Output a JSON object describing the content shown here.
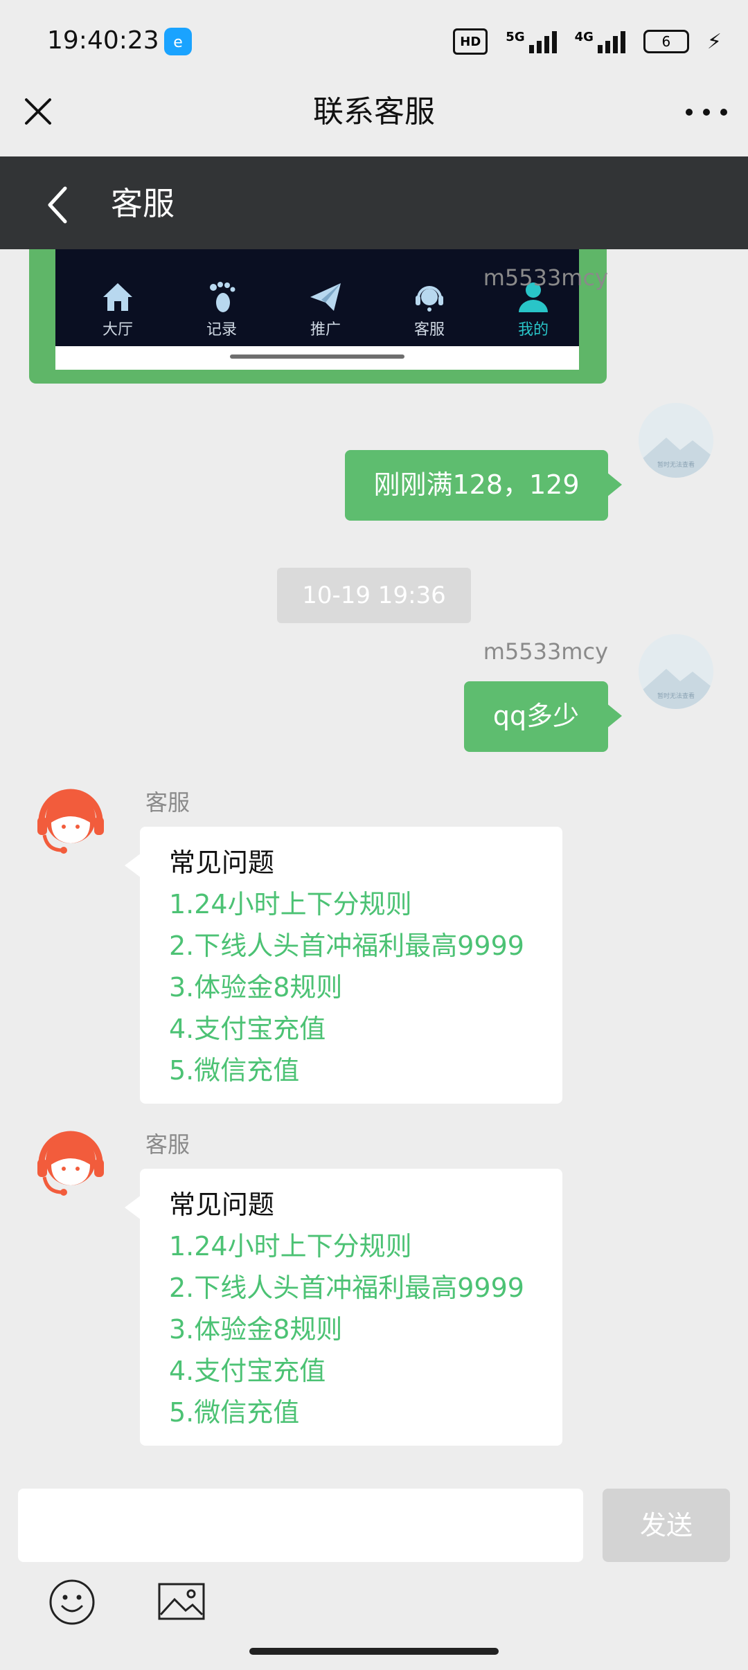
{
  "status_bar": {
    "time": "19:40:23",
    "hd_label": "HD",
    "net1": "5G",
    "net2": "4G",
    "battery": "6"
  },
  "titlebar": {
    "title": "联系客服"
  },
  "header": {
    "title": "客服"
  },
  "image_message": {
    "nav_items": [
      {
        "label": "大厅",
        "icon": "home-icon"
      },
      {
        "label": "记录",
        "icon": "footprint-icon"
      },
      {
        "label": "推广",
        "icon": "paper-plane-icon"
      },
      {
        "label": "客服",
        "icon": "headset-icon"
      },
      {
        "label": "我的",
        "icon": "user-icon"
      }
    ]
  },
  "messages": {
    "sent1": {
      "sender": "m5533mcy",
      "text": "刚刚满128，129"
    },
    "timestamp": "10-19 19:36",
    "sent2": {
      "sender": "m5533mcy",
      "text": "qq多少"
    },
    "recv1": {
      "sender": "客服",
      "title": "常见问题",
      "items": [
        "1.24小时上下分规则",
        "2.下线人头首冲福利最高9999",
        "3.体验金8规则",
        "4.支付宝充值",
        "5.微信充值"
      ]
    },
    "recv2": {
      "sender": "客服",
      "title": "常见问题",
      "items": [
        "1.24小时上下分规则",
        "2.下线人头首冲福利最高9999",
        "3.体验金8规则",
        "4.支付宝充值",
        "5.微信充值"
      ]
    }
  },
  "avatar_placeholder_text": "暂时无法查看",
  "input": {
    "value": "",
    "send_label": "发送"
  },
  "colors": {
    "accent_green": "#5ebd6f",
    "link_green": "#4cc274",
    "header_dark": "#323436",
    "agent_orange": "#f25c3c"
  }
}
